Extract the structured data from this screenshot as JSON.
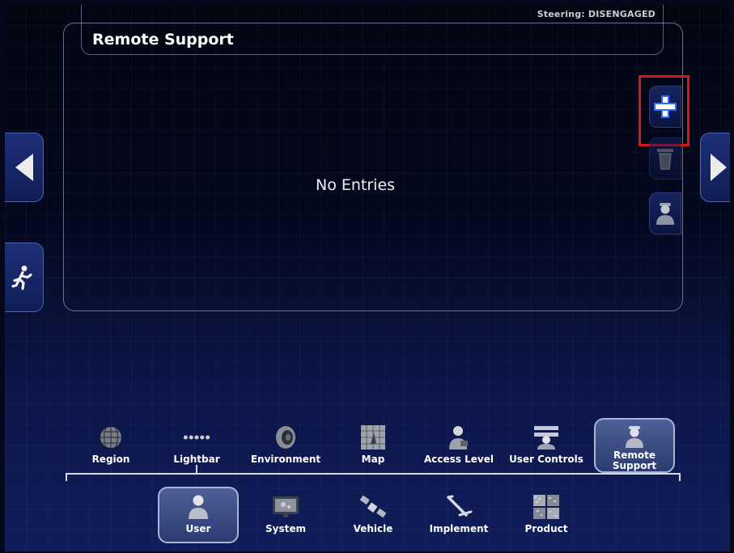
{
  "status": {
    "steering": "Steering: DISENGAGED"
  },
  "panel": {
    "title": "Remote Support",
    "empty_message": "No Entries"
  },
  "side": {
    "left_tab_icon": "triangle-left-icon",
    "exit_icon": "running-man-icon",
    "right_tab_icon": "triangle-right-icon"
  },
  "actions": {
    "add_icon": "plus-icon",
    "delete_icon": "trash-icon",
    "user_icon": "technician-icon"
  },
  "highlight_color": "#d81818",
  "subnav": {
    "items": [
      {
        "label": "Region",
        "icon": "globe-icon"
      },
      {
        "label": "Lightbar",
        "icon": "lightbar-icon"
      },
      {
        "label": "Environment",
        "icon": "speaker-icon"
      },
      {
        "label": "Map",
        "icon": "map-grid-icon"
      },
      {
        "label": "Access Level",
        "icon": "user-badge-icon"
      },
      {
        "label": "User Controls",
        "icon": "user-controls-icon"
      },
      {
        "label": "Remote Support",
        "icon": "remote-support-icon",
        "selected": true
      }
    ]
  },
  "mainnav": {
    "items": [
      {
        "label": "User",
        "icon": "user-icon",
        "selected": true
      },
      {
        "label": "System",
        "icon": "monitor-icon"
      },
      {
        "label": "Vehicle",
        "icon": "satellite-icon"
      },
      {
        "label": "Implement",
        "icon": "implement-icon"
      },
      {
        "label": "Product",
        "icon": "product-icon"
      }
    ]
  }
}
